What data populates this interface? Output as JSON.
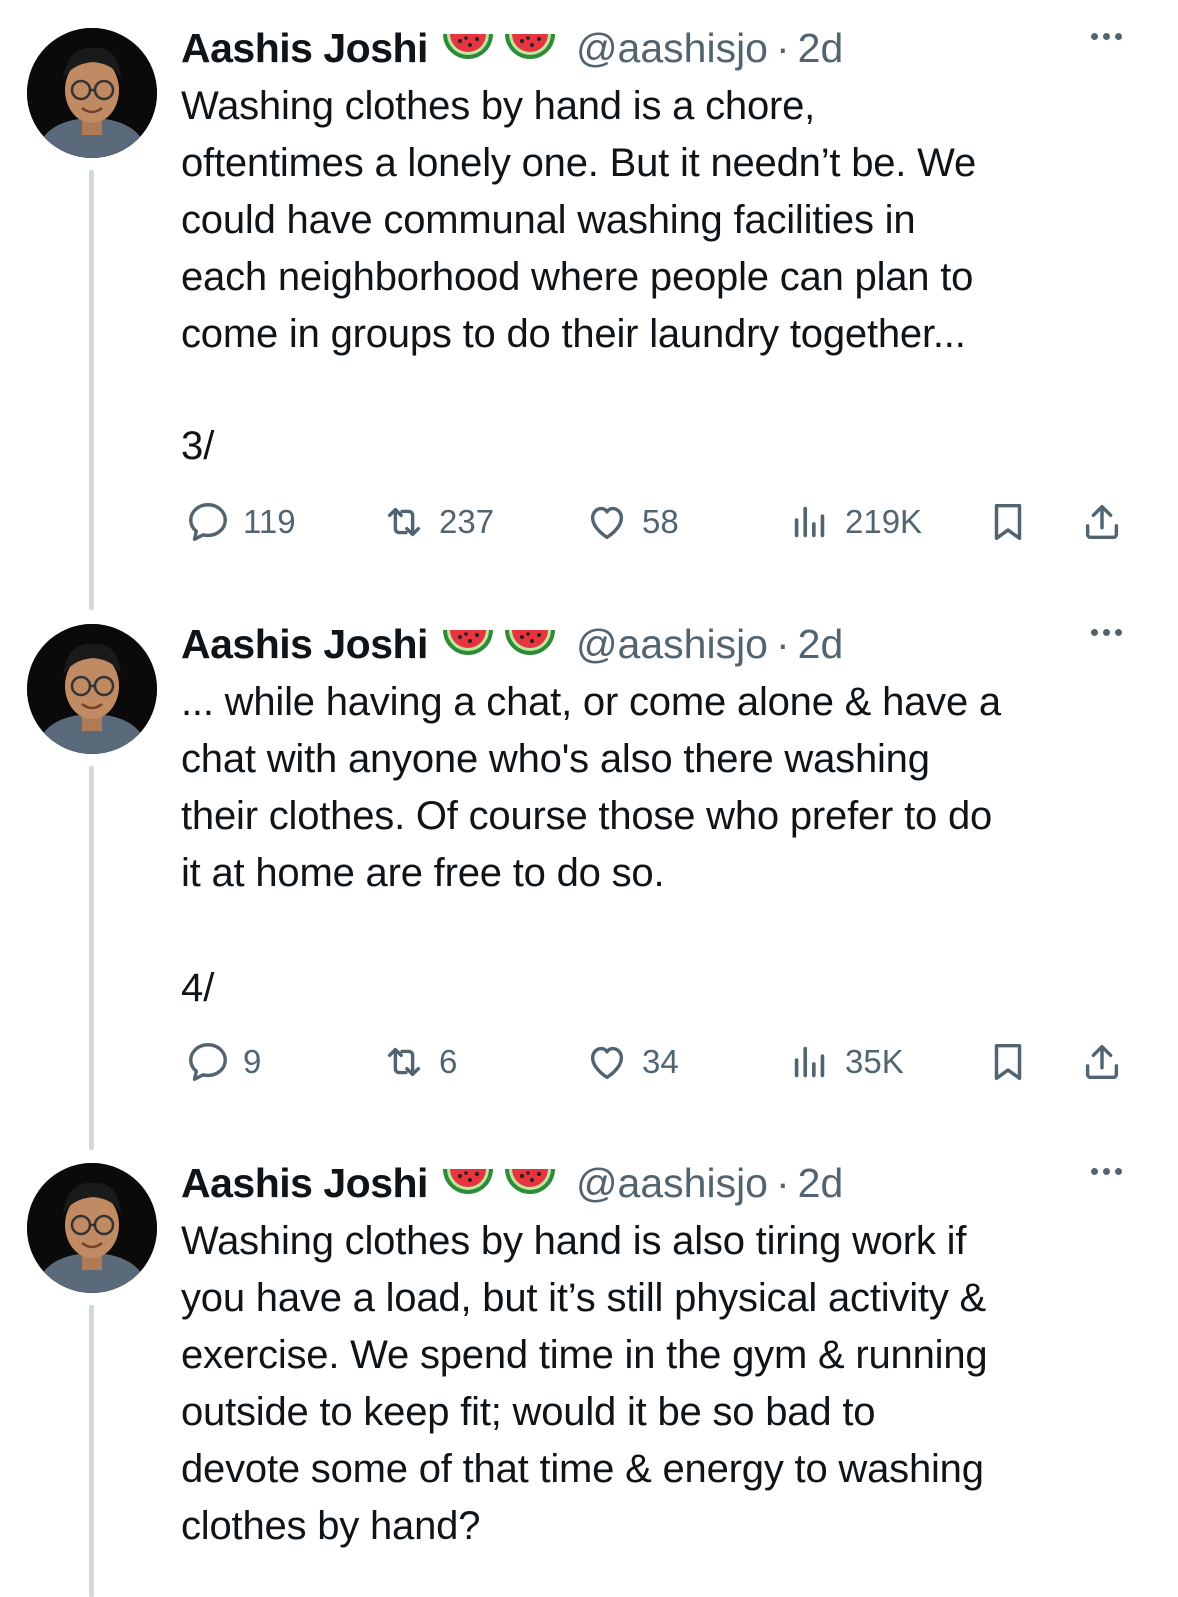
{
  "tweets": [
    {
      "author_name": "Aashis Joshi",
      "badges": [
        "watermelon-emoji",
        "watermelon-emoji"
      ],
      "handle": "@aashisjo",
      "separator": "·",
      "time": "2d",
      "text": "Washing clothes by hand is a chore,\noftentimes a lonely one. But it needn’t be. We\ncould have communal washing facilities in\neach neighborhood where people can plan to\ncome in groups to do their laundry together...",
      "thread_number": "3/",
      "replies": "119",
      "reposts": "237",
      "likes": "58",
      "views": "219K"
    },
    {
      "author_name": "Aashis Joshi",
      "badges": [
        "watermelon-emoji",
        "watermelon-emoji"
      ],
      "handle": "@aashisjo",
      "separator": "·",
      "time": "2d",
      "text": "... while having a chat, or come alone & have a\nchat with anyone who's also there washing\ntheir clothes. Of course those who prefer to do\nit at home are free to do so.",
      "thread_number": "4/",
      "replies": "9",
      "reposts": "6",
      "likes": "34",
      "views": "35K"
    },
    {
      "author_name": "Aashis Joshi",
      "badges": [
        "watermelon-emoji",
        "watermelon-emoji"
      ],
      "handle": "@aashisjo",
      "separator": "·",
      "time": "2d",
      "text": "Washing clothes by hand is also tiring work if\nyou have a load, but it’s still physical activity &\nexercise. We spend time in the gym & running\noutside to keep fit; would it be so bad to\ndevote some of that time & energy to washing\nclothes by hand?"
    }
  ],
  "colors": {
    "text": "#0f1419",
    "secondary": "#536471",
    "thread_line": "#cfd9de",
    "background": "#ffffff"
  },
  "icons": [
    "reply-icon",
    "repost-icon",
    "like-icon",
    "views-icon",
    "bookmark-icon",
    "share-icon",
    "more-icon"
  ]
}
